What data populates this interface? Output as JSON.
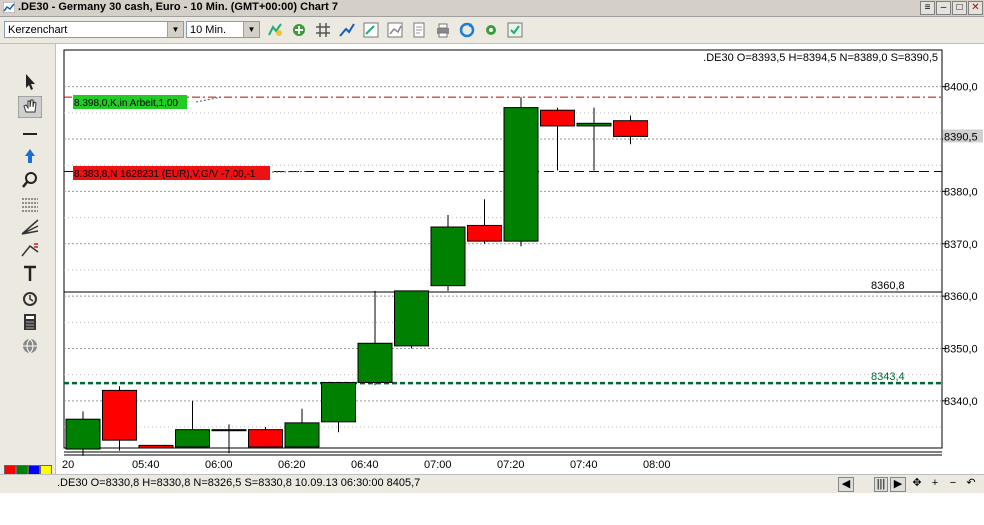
{
  "window": {
    "title": ".DE30 - Germany 30 cash, Euro - 10 Min. (GMT+00:00)   Chart 7",
    "buttons": [
      "≡",
      "–",
      "□",
      "✕"
    ]
  },
  "toolbar": {
    "chart_type": "Kerzenchart",
    "interval": "10 Min."
  },
  "status": {
    "text": ".DE30 O=8330,8 H=8330,8 N=8326,5 S=8330,8   10.09.13 06:30:00 8405,7"
  },
  "colors": {
    "up": "#008000",
    "down": "#ff0000",
    "order_line": "#cc0000",
    "position_line": "#000080",
    "alert_line": "#006633",
    "hline": "#000000"
  },
  "chart_data": {
    "type": "candlestick",
    "symbol": ".DE30",
    "header": ".DE30 O=8393,5 H=8394,5 N=8389,0 S=8390,5",
    "x_labels": [
      "20",
      "05:40",
      "06:00",
      "06:20",
      "06:40",
      "07:00",
      "07:20",
      "07:40",
      "08:00"
    ],
    "y_ticks": [
      8340,
      8350,
      8360,
      8370,
      8380,
      8390,
      8400
    ],
    "y_tick_labels": [
      "8340,0",
      "8350,0",
      "8360,0",
      "8370,0",
      "8380,0",
      "8390,5",
      "8400,0"
    ],
    "ylim": [
      8331,
      8407
    ],
    "candles": [
      {
        "time": "05:30",
        "open": 8330.8,
        "high": 8338.0,
        "low": 8329.5,
        "close": 8336.5
      },
      {
        "time": "05:40",
        "open": 8342.0,
        "high": 8342.8,
        "low": 8330.5,
        "close": 8332.5
      },
      {
        "time": "05:50",
        "open": 8331.5,
        "high": 8331.5,
        "low": 8331.0,
        "close": 8331.0
      },
      {
        "time": "06:00",
        "open": 8331.2,
        "high": 8340.0,
        "low": 8331.0,
        "close": 8334.5
      },
      {
        "time": "06:10",
        "open": 8334.3,
        "high": 8335.5,
        "low": 8330.0,
        "close": 8334.5
      },
      {
        "time": "06:20",
        "open": 8334.5,
        "high": 8335.0,
        "low": 8331.0,
        "close": 8331.2
      },
      {
        "time": "06:40",
        "open": 8331.2,
        "high": 8338.5,
        "low": 8331.0,
        "close": 8335.8
      },
      {
        "time": "06:50",
        "open": 8336.0,
        "high": 8343.5,
        "low": 8334.0,
        "close": 8343.5
      },
      {
        "time": "07:00",
        "open": 8343.5,
        "high": 8361.0,
        "low": 8343.0,
        "close": 8351.0
      },
      {
        "time": "07:10",
        "open": 8350.5,
        "high": 8361.0,
        "low": 8350.0,
        "close": 8361.0
      },
      {
        "time": "07:20",
        "open": 8362.0,
        "high": 8375.5,
        "low": 8361.0,
        "close": 8373.2
      },
      {
        "time": "07:30",
        "open": 8373.5,
        "high": 8378.5,
        "low": 8370.0,
        "close": 8370.5
      },
      {
        "time": "07:40",
        "open": 8370.5,
        "high": 8398.0,
        "low": 8369.5,
        "close": 8396.0
      },
      {
        "time": "07:50",
        "open": 8395.5,
        "high": 8396.0,
        "low": 8384.0,
        "close": 8392.5
      },
      {
        "time": "08:00",
        "open": 8392.5,
        "high": 8396.0,
        "low": 8384.0,
        "close": 8393.0
      },
      {
        "time": "08:10",
        "open": 8393.5,
        "high": 8394.5,
        "low": 8389.0,
        "close": 8390.5
      }
    ],
    "lines": [
      {
        "kind": "order",
        "value": 8398.0,
        "label": "8.398,0,K,in Arbeit,1,00"
      },
      {
        "kind": "position",
        "value": 8383.8,
        "label": "8.383,8,N 1628231 (EUR),V,G/V -7,00,-1"
      },
      {
        "kind": "hline",
        "value": 8360.8,
        "label": "8360,8"
      },
      {
        "kind": "alert",
        "value": 8343.4,
        "label": "8343,4"
      }
    ]
  }
}
